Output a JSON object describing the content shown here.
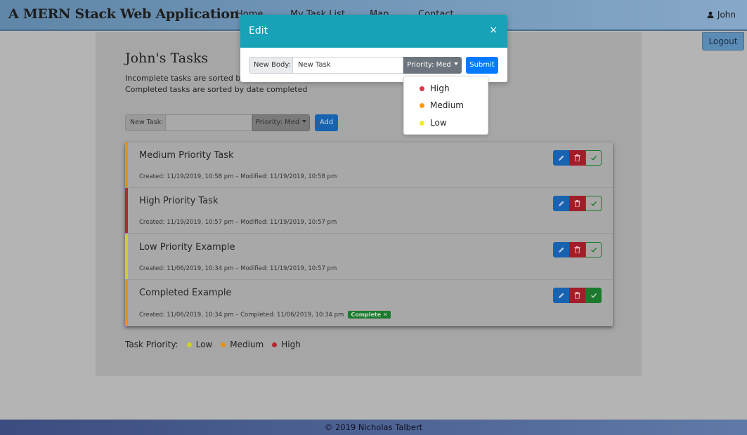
{
  "navbar": {
    "brand": "A MERN Stack Web Application",
    "links": [
      "Home",
      "My Task List",
      "Map",
      "Contact"
    ],
    "user": "John",
    "logout": "Logout"
  },
  "page": {
    "title": "John's Tasks",
    "subtitle1": "Incomplete tasks are sorted by",
    "subtitle2": "Completed tasks are sorted by date completed"
  },
  "new_task": {
    "label": "New Task:",
    "priority": "Priority: Med",
    "add": "Add"
  },
  "tasks": [
    {
      "title": "Medium Priority Task",
      "meta": "Created: 11/19/2019, 10:58 pm – Modified: 11/19/2019, 10:58 pm",
      "color": "#e8910c",
      "completed": false
    },
    {
      "title": "High Priority Task",
      "meta": "Created: 11/19/2019, 10:57 pm – Modified: 11/19/2019, 10:57 pm",
      "color": "#b8262e",
      "completed": false
    },
    {
      "title": "Low Priority Example",
      "meta": "Created: 11/06/2019, 10:34 pm – Modified: 11/19/2019, 10:57 pm",
      "color": "#cfd023",
      "completed": false
    },
    {
      "title": "Completed Example",
      "meta": "Created: 11/06/2019, 10:34 pm – Completed: 11/06/2019, 10:34 pm",
      "color": "#e8910c",
      "completed": true,
      "badge": "Complete ✕"
    }
  ],
  "legend": {
    "label": "Task Priority:",
    "items": [
      {
        "label": "Low",
        "color": "#cfd023"
      },
      {
        "label": "Medium",
        "color": "#e8910c"
      },
      {
        "label": "High",
        "color": "#b8262e"
      }
    ]
  },
  "modal": {
    "title": "Edit",
    "close": "×",
    "body_label": "New Body:",
    "body_value": "New Task",
    "priority": "Priority: Med",
    "submit": "Submit"
  },
  "dropdown": {
    "items": [
      {
        "label": "High",
        "color": "#dc3545"
      },
      {
        "label": "Medium",
        "color": "#fd9a0a"
      },
      {
        "label": "Low",
        "color": "#f2ed2a"
      }
    ]
  },
  "footer": "© 2019 Nicholas Talbert"
}
